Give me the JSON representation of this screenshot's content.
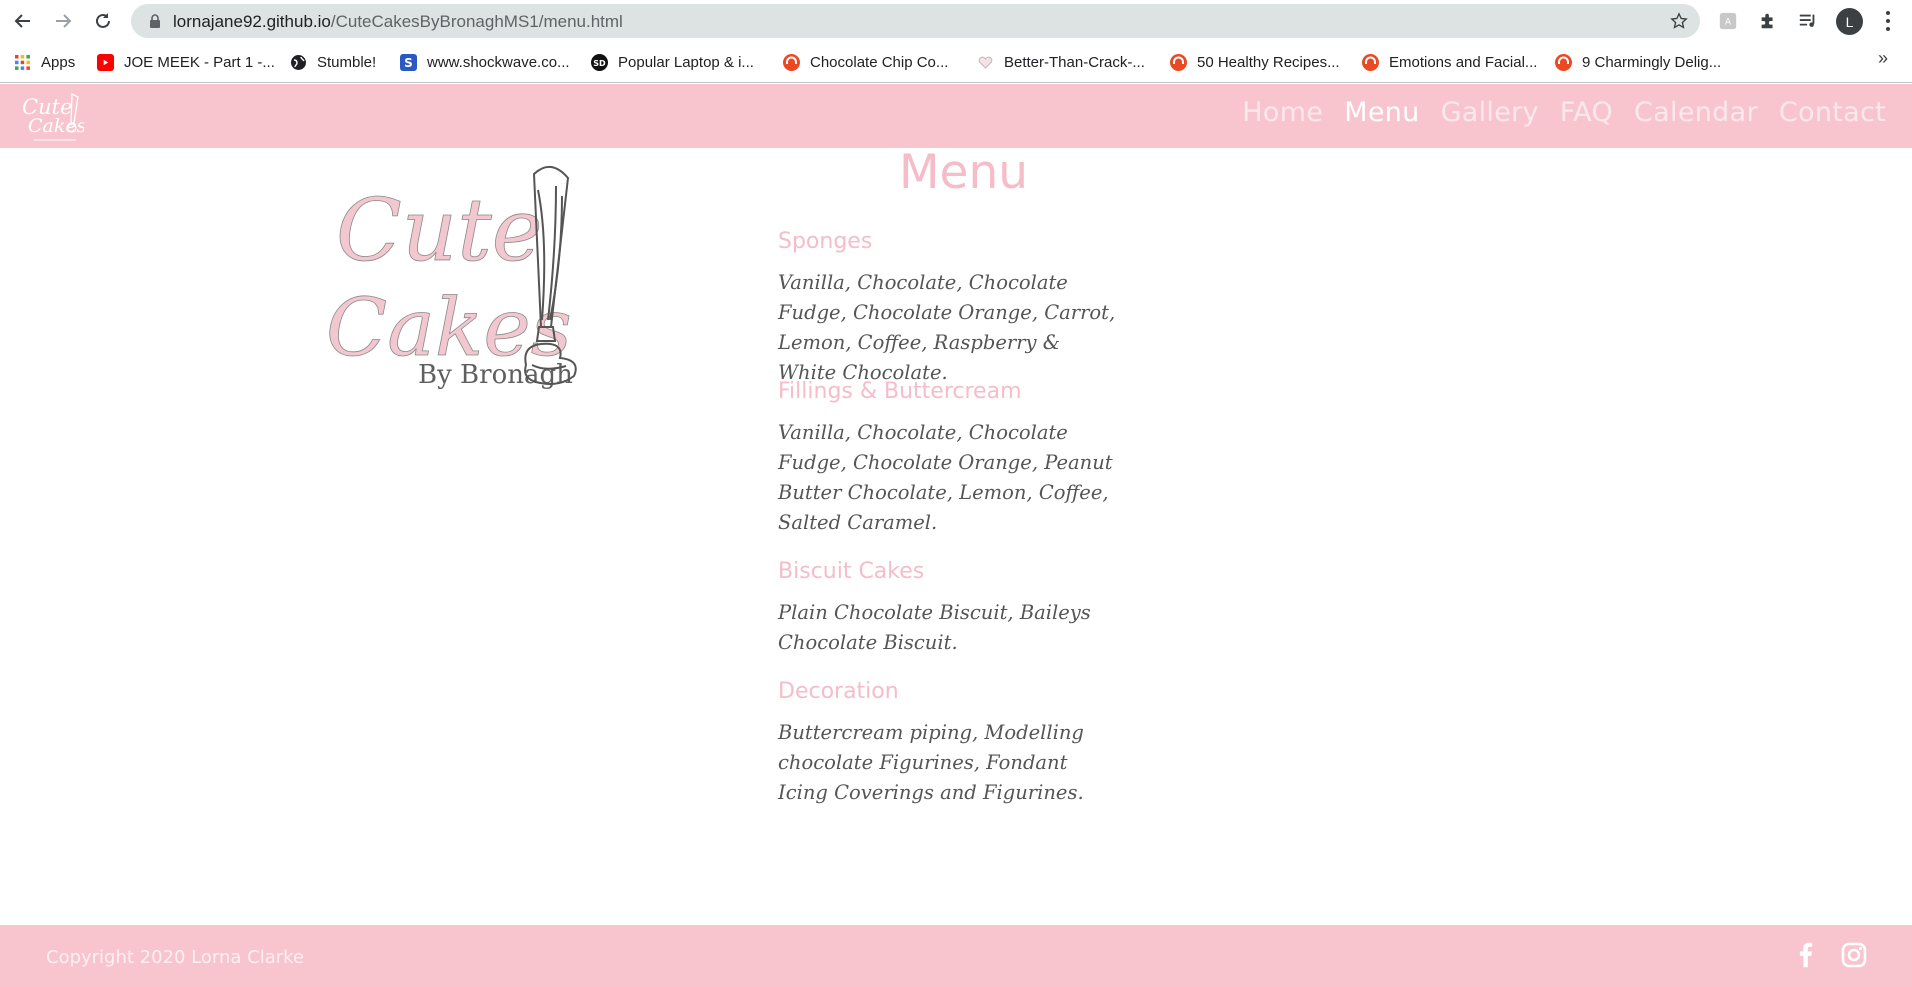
{
  "browser": {
    "url_host": "lornajane92.github.io",
    "url_path": "/CuteCakesByBronaghMS1/menu.html",
    "profile_initial": "L",
    "bookmarks": [
      {
        "label": "Apps",
        "icon": "apps-grid-icon"
      },
      {
        "label": "JOE MEEK - Part 1 -...",
        "icon": "youtube-icon"
      },
      {
        "label": "Stumble!",
        "icon": "globe-icon"
      },
      {
        "label": "www.shockwave.co...",
        "icon": "shockwave-icon"
      },
      {
        "label": "Popular Laptop & i...",
        "icon": "sd-icon"
      },
      {
        "label": "Chocolate Chip Co...",
        "icon": "stumbleupon-icon"
      },
      {
        "label": "Better-Than-Crack-...",
        "icon": "heart-icon"
      },
      {
        "label": "50 Healthy Recipes...",
        "icon": "stumbleupon-icon"
      },
      {
        "label": "Emotions and Facial...",
        "icon": "stumbleupon-icon"
      },
      {
        "label": "9 Charmingly Delig...",
        "icon": "stumbleupon-icon"
      }
    ],
    "bookmarks_overflow": "»"
  },
  "site": {
    "logo_text": "Cute Cakes",
    "nav": [
      {
        "label": "Home",
        "active": false
      },
      {
        "label": "Menu",
        "active": true
      },
      {
        "label": "Gallery",
        "active": false
      },
      {
        "label": "FAQ",
        "active": false
      },
      {
        "label": "Calendar",
        "active": false
      },
      {
        "label": "Contact",
        "active": false
      }
    ],
    "hero_logo": {
      "line1": "Cute",
      "line2": "Cakes",
      "line3": "By Bronagh"
    }
  },
  "main": {
    "heading": "Menu",
    "sections": [
      {
        "title": "Sponges",
        "body": "Vanilla, Chocolate, Chocolate Fudge, Chocolate Orange, Carrot, Lemon, Coffee, Raspberry & White Chocolate."
      },
      {
        "title": "Fillings & Buttercream",
        "body": "Vanilla, Chocolate, Chocolate Fudge, Chocolate Orange, Peanut Butter Chocolate, Lemon, Coffee, Salted Caramel."
      },
      {
        "title": "Biscuit Cakes",
        "body": "Plain Chocolate Biscuit, Baileys Chocolate Biscuit."
      },
      {
        "title": "Decoration",
        "body": "Buttercream piping, Modelling chocolate Figurines, Fondant Icing Coverings and Figurines."
      }
    ]
  },
  "footer": {
    "copyright": "Copyright 2020 Lorna Clarke",
    "social": [
      "facebook-icon",
      "instagram-icon"
    ]
  },
  "colors": {
    "brand_pink": "#f8c5cf",
    "heading_pink": "#f5bcc9",
    "body_text": "#555555"
  }
}
